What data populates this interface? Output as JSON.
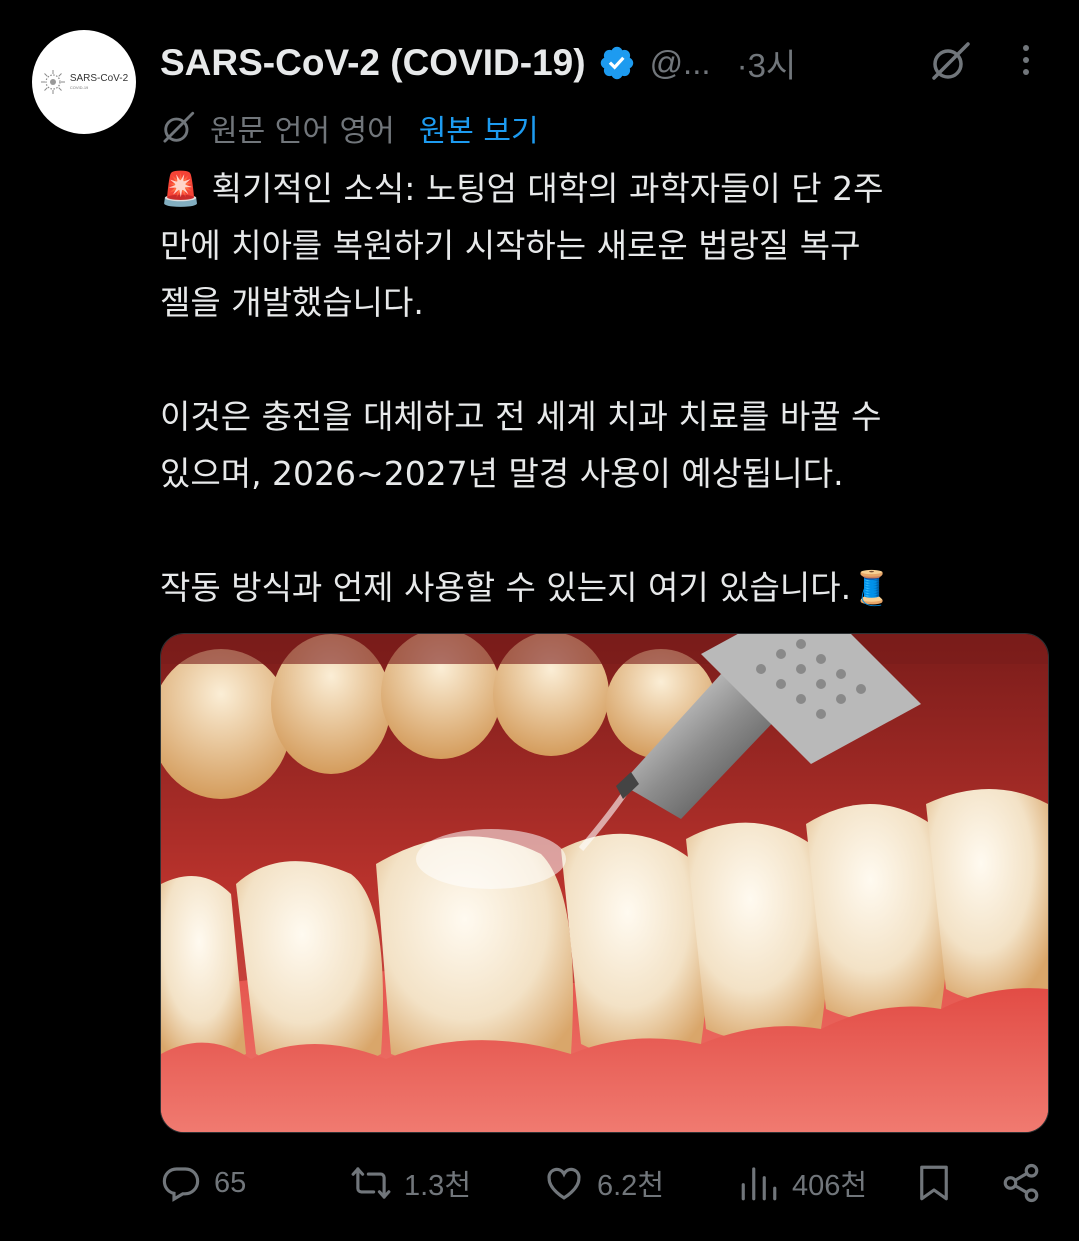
{
  "tweet": {
    "author_name": "SARS-CoV-2 (COVID-19)",
    "handle": "@...",
    "time": "·3시",
    "avatar_text": "SARS-CoV-2",
    "avatar_subtext": "COVID-19",
    "translation": {
      "label": "원문 언어 영어",
      "link": "원본 보기"
    },
    "paragraphs": [
      {
        "emoji": "🚨",
        "lines": [
          "획기적인 소식: 노팅엄 대학의 과학자들이 단 2주",
          "만에 치아를 복원하기 시작하는 새로운 법랑질 복구",
          "젤을 개발했습니다."
        ]
      },
      {
        "lines": [
          "이것은 충전을 대체하고 전 세계 치과 치료를 바꿀 수",
          "있으며, 2026~2027년 말경 사용이 예상됩니다."
        ]
      },
      {
        "lines": [
          "작동 방식과 언제 사용할 수 있는지 여기 있습니다."
        ],
        "trailing_emoji": "🧵"
      }
    ],
    "stats": {
      "replies": "65",
      "reposts": "1.3천",
      "likes": "6.2천",
      "views": "406천"
    }
  },
  "colors": {
    "background": "#000000",
    "text": "#e7e9ea",
    "muted": "#71767b",
    "accent": "#1d9bf0"
  },
  "icons": [
    "verified-badge-icon",
    "grok-icon",
    "more-icon",
    "translate-icon",
    "reply-icon",
    "repost-icon",
    "like-icon",
    "views-icon",
    "bookmark-icon",
    "share-icon"
  ]
}
